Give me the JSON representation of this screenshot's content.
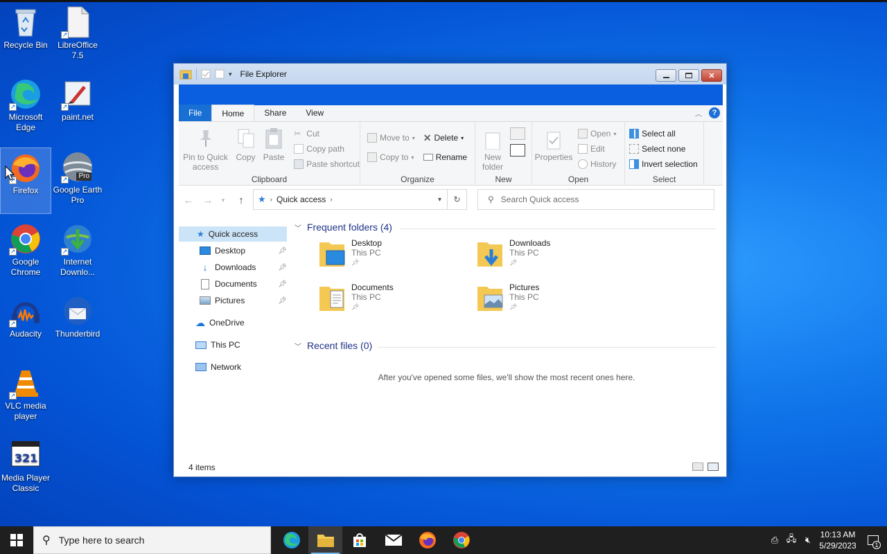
{
  "desktop": {
    "icons": [
      {
        "label": "Recycle Bin",
        "icon": "recycle-bin-icon"
      },
      {
        "label": "LibreOffice 7.5",
        "icon": "libreoffice-icon"
      },
      {
        "label": "Microsoft Edge",
        "icon": "edge-icon"
      },
      {
        "label": "paint.net",
        "icon": "paintnet-icon"
      },
      {
        "label": "Firefox",
        "icon": "firefox-icon"
      },
      {
        "label": "Google Earth Pro",
        "icon": "google-earth-icon"
      },
      {
        "label": "Google Chrome",
        "icon": "chrome-icon"
      },
      {
        "label": "Internet Downlo...",
        "icon": "internet-download-manager-icon"
      },
      {
        "label": "Audacity",
        "icon": "audacity-icon"
      },
      {
        "label": "Thunderbird",
        "icon": "thunderbird-icon"
      },
      {
        "label": "VLC media player",
        "icon": "vlc-icon"
      },
      {
        "label": "Media Player Classic",
        "icon": "media-player-classic-icon"
      }
    ],
    "earth_badge": "Pro"
  },
  "window": {
    "title": "File Explorer",
    "tabs": {
      "file": "File",
      "home": "Home",
      "share": "Share",
      "view": "View"
    },
    "help": "?",
    "ribbon": {
      "clipboard": {
        "label": "Clipboard",
        "pin": "Pin to Quick access",
        "copy": "Copy",
        "paste": "Paste",
        "cut": "Cut",
        "copy_path": "Copy path",
        "paste_shortcut": "Paste shortcut"
      },
      "organize": {
        "label": "Organize",
        "move_to": "Move to",
        "copy_to": "Copy to",
        "delete": "Delete",
        "rename": "Rename"
      },
      "new": {
        "label": "New",
        "new_folder": "New folder"
      },
      "open": {
        "label": "Open",
        "properties": "Properties",
        "open": "Open",
        "edit": "Edit",
        "history": "History"
      },
      "select": {
        "label": "Select",
        "select_all": "Select all",
        "select_none": "Select none",
        "invert": "Invert selection"
      }
    },
    "address": {
      "location": "Quick access"
    },
    "search": {
      "placeholder": "Search Quick access"
    },
    "nav": {
      "quick_access": "Quick access",
      "desktop": "Desktop",
      "downloads": "Downloads",
      "documents": "Documents",
      "pictures": "Pictures",
      "onedrive": "OneDrive",
      "this_pc": "This PC",
      "network": "Network"
    },
    "content": {
      "frequent_header": "Frequent folders (4)",
      "recent_header": "Recent files (0)",
      "folders": [
        {
          "name": "Desktop",
          "location": "This PC"
        },
        {
          "name": "Downloads",
          "location": "This PC"
        },
        {
          "name": "Documents",
          "location": "This PC"
        },
        {
          "name": "Pictures",
          "location": "This PC"
        }
      ],
      "empty_message": "After you've opened some files, we'll show the most recent ones here."
    },
    "status": {
      "items": "4 items"
    }
  },
  "taskbar": {
    "search_placeholder": "Type here to search",
    "time": "10:13 AM",
    "date": "5/29/2023",
    "notification_count": "1"
  },
  "colors": {
    "accent": "#0a5fe0",
    "file_tab": "#1970d4",
    "nav_selected": "#cce4f7",
    "section_header": "#1e3287"
  }
}
